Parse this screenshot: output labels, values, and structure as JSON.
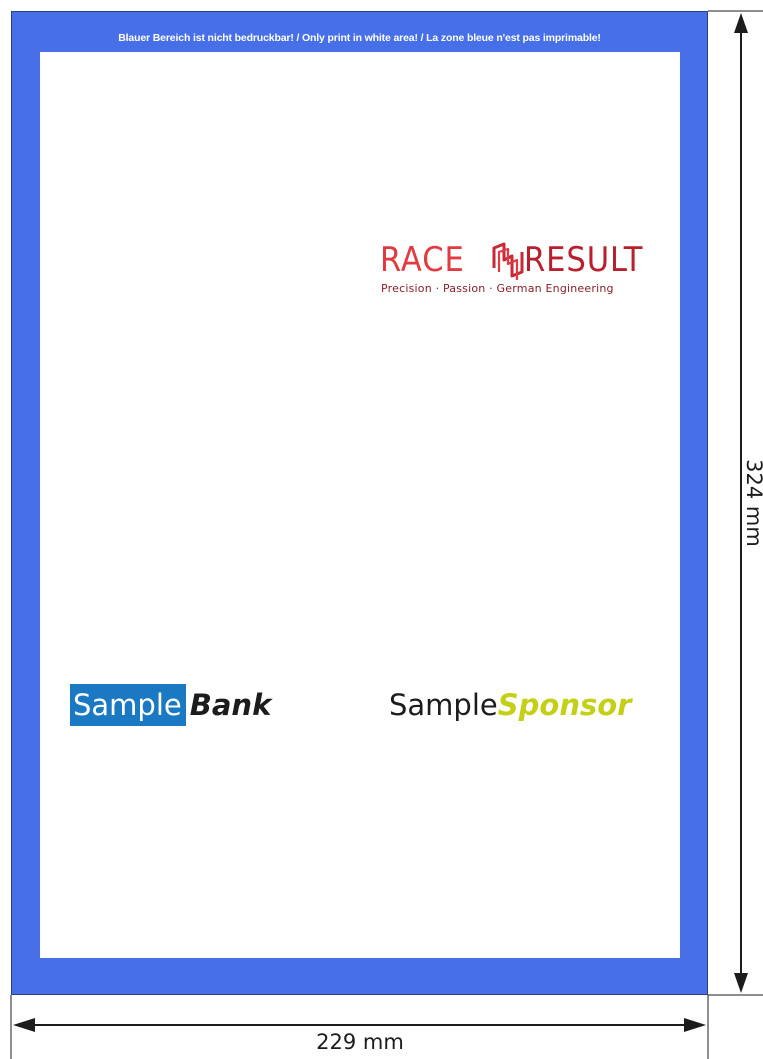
{
  "notice": "Blauer Bereich ist nicht bedruckbar! / Only print in white area! / La zone bleue n'est pas imprimable!",
  "logos": {
    "race_result": {
      "word1": "RACE",
      "word2": "RESULT",
      "tagline": "Precision · Passion · German Engineering"
    },
    "sample_bank": {
      "word1": "Sample",
      "word2": "Bank"
    },
    "sample_sponsor": {
      "word1": "Sample",
      "word2": "Sponsor"
    }
  },
  "dimensions": {
    "width": "229 mm",
    "height": "324 mm"
  },
  "colors": {
    "non_print_area": "#476fe8",
    "print_area": "#ffffff",
    "race_red": "#e23a40",
    "result_red": "#b8202e",
    "bank_blue": "#1b79c3",
    "sponsor_yellow_green": "#c4d017"
  }
}
